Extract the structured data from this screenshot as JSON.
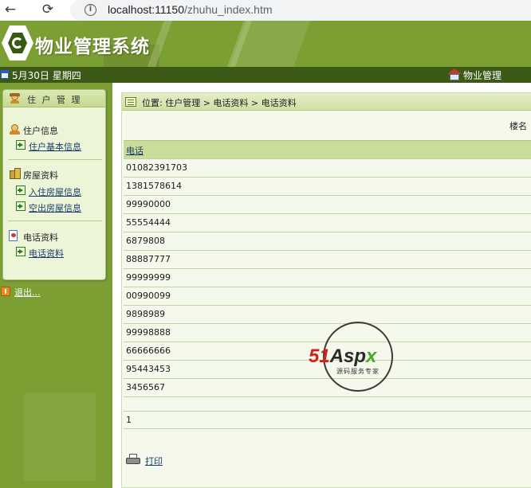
{
  "browser": {
    "back_glyph": "←",
    "reload_glyph": "⟳",
    "url_host": "localhost:11150",
    "url_path": "/zhuhu_index.htm"
  },
  "header": {
    "title": "物业管理系统"
  },
  "statusbar": {
    "date": "5月30日 星期四",
    "home_label": "物业管理"
  },
  "sidebar": {
    "panel_title": "住 户 管 理",
    "groups": [
      {
        "title": "住户信息",
        "items": [
          "住户基本信息"
        ]
      },
      {
        "title": "房屋资料",
        "items": [
          "入住房屋信息",
          "空出房屋信息"
        ]
      },
      {
        "title": "电话资料",
        "items": [
          "电话资料"
        ]
      }
    ],
    "exit_label": "退出..."
  },
  "main": {
    "breadcrumb": "位置: 住户管理 > 电话资料 > 电话资料",
    "floor_label": "楼名",
    "table": {
      "header": "电话",
      "rows": [
        "01082391703",
        "1381578614",
        "99990000",
        "55554444",
        "6879808",
        "88887777",
        "99999999",
        "00990099",
        "9898989",
        "99998888",
        "66666666",
        "95443453",
        "3456567",
        ""
      ],
      "pager": "1"
    },
    "print_label": "打印"
  },
  "watermark": {
    "brand_part1": "51",
    "brand_part2": "Asp",
    "brand_part3": "x",
    "subtitle": "源码服务专家"
  },
  "colors": {
    "header_green": "#7c9f34",
    "status_dark": "#3c5a17",
    "table_head": "#c9dc99"
  }
}
